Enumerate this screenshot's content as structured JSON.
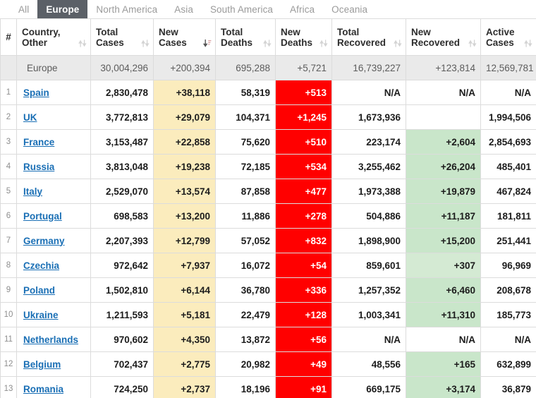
{
  "tabs": [
    {
      "label": "All",
      "active": false
    },
    {
      "label": "Europe",
      "active": true
    },
    {
      "label": "North America",
      "active": false
    },
    {
      "label": "Asia",
      "active": false
    },
    {
      "label": "South America",
      "active": false
    },
    {
      "label": "Africa",
      "active": false
    },
    {
      "label": "Oceania",
      "active": false
    }
  ],
  "columns": [
    {
      "key": "rank",
      "label": "#",
      "sort": "none",
      "name": "column-header-rank"
    },
    {
      "key": "country",
      "label": "Country,\nOther",
      "sort": "unsorted",
      "name": "column-header-country"
    },
    {
      "key": "totalcases",
      "label": "Total\nCases",
      "sort": "unsorted",
      "name": "column-header-total-cases"
    },
    {
      "key": "newcases",
      "label": "New\nCases",
      "sort": "desc",
      "name": "column-header-new-cases"
    },
    {
      "key": "totaldeaths",
      "label": "Total\nDeaths",
      "sort": "unsorted",
      "name": "column-header-total-deaths"
    },
    {
      "key": "newdeaths",
      "label": "New\nDeaths",
      "sort": "unsorted",
      "name": "column-header-new-deaths"
    },
    {
      "key": "totalrec",
      "label": "Total\nRecovered",
      "sort": "unsorted",
      "name": "column-header-total-recovered"
    },
    {
      "key": "newrec",
      "label": "New\nRecovered",
      "sort": "unsorted",
      "name": "column-header-new-recovered"
    },
    {
      "key": "activecases",
      "label": "Active\nCases",
      "sort": "unsorted",
      "name": "column-header-active-cases"
    }
  ],
  "summary_row": {
    "name": "Europe",
    "totalcases": "30,004,296",
    "newcases": "+200,394",
    "totaldeaths": "695,288",
    "newdeaths": "+5,721",
    "totalrec": "16,739,227",
    "newrec": "+123,814",
    "activecases": "12,569,781"
  },
  "rows": [
    {
      "rank": "1",
      "country": "Spain",
      "totalcases": "2,830,478",
      "newcases": "+38,118",
      "totaldeaths": "58,319",
      "newdeaths": "+513",
      "totalrec": "N/A",
      "newrec": "N/A",
      "activecases": "N/A",
      "newrec_style": "blank"
    },
    {
      "rank": "2",
      "country": "UK",
      "totalcases": "3,772,813",
      "newcases": "+29,079",
      "totaldeaths": "104,371",
      "newdeaths": "+1,245",
      "totalrec": "1,673,936",
      "newrec": "",
      "activecases": "1,994,506",
      "newrec_style": "blank"
    },
    {
      "rank": "3",
      "country": "France",
      "totalcases": "3,153,487",
      "newcases": "+22,858",
      "totaldeaths": "75,620",
      "newdeaths": "+510",
      "totalrec": "223,174",
      "newrec": "+2,604",
      "activecases": "2,854,693",
      "newrec_style": "green"
    },
    {
      "rank": "4",
      "country": "Russia",
      "totalcases": "3,813,048",
      "newcases": "+19,238",
      "totaldeaths": "72,185",
      "newdeaths": "+534",
      "totalrec": "3,255,462",
      "newrec": "+26,204",
      "activecases": "485,401",
      "newrec_style": "green"
    },
    {
      "rank": "5",
      "country": "Italy",
      "totalcases": "2,529,070",
      "newcases": "+13,574",
      "totaldeaths": "87,858",
      "newdeaths": "+477",
      "totalrec": "1,973,388",
      "newrec": "+19,879",
      "activecases": "467,824",
      "newrec_style": "green"
    },
    {
      "rank": "6",
      "country": "Portugal",
      "totalcases": "698,583",
      "newcases": "+13,200",
      "totaldeaths": "11,886",
      "newdeaths": "+278",
      "totalrec": "504,886",
      "newrec": "+11,187",
      "activecases": "181,811",
      "newrec_style": "green"
    },
    {
      "rank": "7",
      "country": "Germany",
      "totalcases": "2,207,393",
      "newcases": "+12,799",
      "totaldeaths": "57,052",
      "newdeaths": "+832",
      "totalrec": "1,898,900",
      "newrec": "+15,200",
      "activecases": "251,441",
      "newrec_style": "green"
    },
    {
      "rank": "8",
      "country": "Czechia",
      "totalcases": "972,642",
      "newcases": "+7,937",
      "totaldeaths": "16,072",
      "newdeaths": "+54",
      "totalrec": "859,601",
      "newrec": "+307",
      "activecases": "96,969",
      "newrec_style": "green-light"
    },
    {
      "rank": "9",
      "country": "Poland",
      "totalcases": "1,502,810",
      "newcases": "+6,144",
      "totaldeaths": "36,780",
      "newdeaths": "+336",
      "totalrec": "1,257,352",
      "newrec": "+6,460",
      "activecases": "208,678",
      "newrec_style": "green"
    },
    {
      "rank": "10",
      "country": "Ukraine",
      "totalcases": "1,211,593",
      "newcases": "+5,181",
      "totaldeaths": "22,479",
      "newdeaths": "+128",
      "totalrec": "1,003,341",
      "newrec": "+11,310",
      "activecases": "185,773",
      "newrec_style": "green"
    },
    {
      "rank": "11",
      "country": "Netherlands",
      "totalcases": "970,602",
      "newcases": "+4,350",
      "totaldeaths": "13,872",
      "newdeaths": "+56",
      "totalrec": "N/A",
      "newrec": "N/A",
      "activecases": "N/A",
      "newrec_style": "blank"
    },
    {
      "rank": "12",
      "country": "Belgium",
      "totalcases": "702,437",
      "newcases": "+2,775",
      "totaldeaths": "20,982",
      "newdeaths": "+49",
      "totalrec": "48,556",
      "newrec": "+165",
      "activecases": "632,899",
      "newrec_style": "green"
    },
    {
      "rank": "13",
      "country": "Romania",
      "totalcases": "724,250",
      "newcases": "+2,737",
      "totaldeaths": "18,196",
      "newdeaths": "+91",
      "totalrec": "669,175",
      "newrec": "+3,174",
      "activecases": "36,879",
      "newrec_style": "green"
    }
  ],
  "colors": {
    "tab_active_bg": "#5b6067",
    "new_cases_bg": "#fbecbd",
    "new_deaths_bg": "#ff0000",
    "new_recovered_bg": "#c9e6ca",
    "summary_bg": "#eaeaea",
    "link": "#1a6fb5"
  }
}
